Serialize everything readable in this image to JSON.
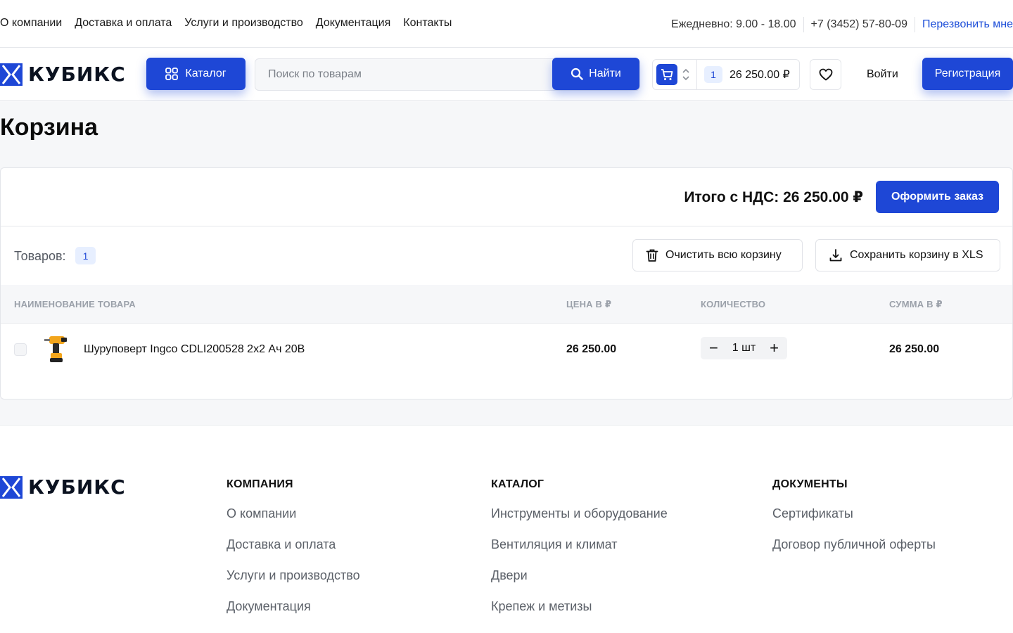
{
  "topbar": {
    "nav": [
      "О компании",
      "Доставка и оплата",
      "Услуги и производство",
      "Документация",
      "Контакты"
    ],
    "hours": "Ежедневно: 9.00 - 18.00",
    "phone": "+7 (3452) 57-80-09",
    "callback": "Перезвонить мне"
  },
  "header": {
    "logo_text": "КУБИКС",
    "catalog_label": "Каталог",
    "search_placeholder": "Поиск по товарам",
    "find_label": "Найти",
    "cart_count": "1",
    "cart_sum": "26 250.00 ₽",
    "login_label": "Войти",
    "register_label": "Регистрация"
  },
  "page": {
    "title": "Корзина",
    "total_label": "Итого с НДС: 26 250.00 ₽",
    "order_label": "Оформить заказ",
    "goods_label": "Товаров:",
    "goods_count": "1",
    "clear_label": "Очистить всю корзину",
    "xls_label": "Сохранить корзину в XLS",
    "columns": {
      "name": "НАИМЕНОВАНИЕ ТОВАРА",
      "price": "ЦЕНА В ₽",
      "qty": "КОЛИЧЕСТВО",
      "sum": "СУММА В ₽"
    },
    "items": [
      {
        "name": "Шуруповерт Ingco CDLI200528 2х2 Ач 20В",
        "price": "26 250.00",
        "qty": "1 шт",
        "sum": "26 250.00",
        "selected": false
      }
    ]
  },
  "footer": {
    "logo_text": "КУБИКС",
    "columns": [
      {
        "title": "КОМПАНИЯ",
        "links": [
          "О компании",
          "Доставка и оплата",
          "Услуги и производство",
          "Документация"
        ]
      },
      {
        "title": "КАТАЛОГ",
        "links": [
          "Инструменты и оборудование",
          "Вентиляция и климат",
          "Двери",
          "Крепеж и метизы"
        ]
      },
      {
        "title": "ДОКУМЕНТЫ",
        "links": [
          "Сертификаты",
          "Договор публичной оферты"
        ]
      }
    ]
  },
  "colors": {
    "accent": "#1e47d6",
    "badge_bg": "#e7efff",
    "page_bg": "#f6f7f9"
  },
  "icons": [
    "logo-mark-icon",
    "grid-icon",
    "search-icon",
    "cart-icon",
    "sort-arrows-icon",
    "heart-icon",
    "trash-icon",
    "download-icon",
    "minus-icon",
    "plus-icon",
    "drill-image"
  ]
}
